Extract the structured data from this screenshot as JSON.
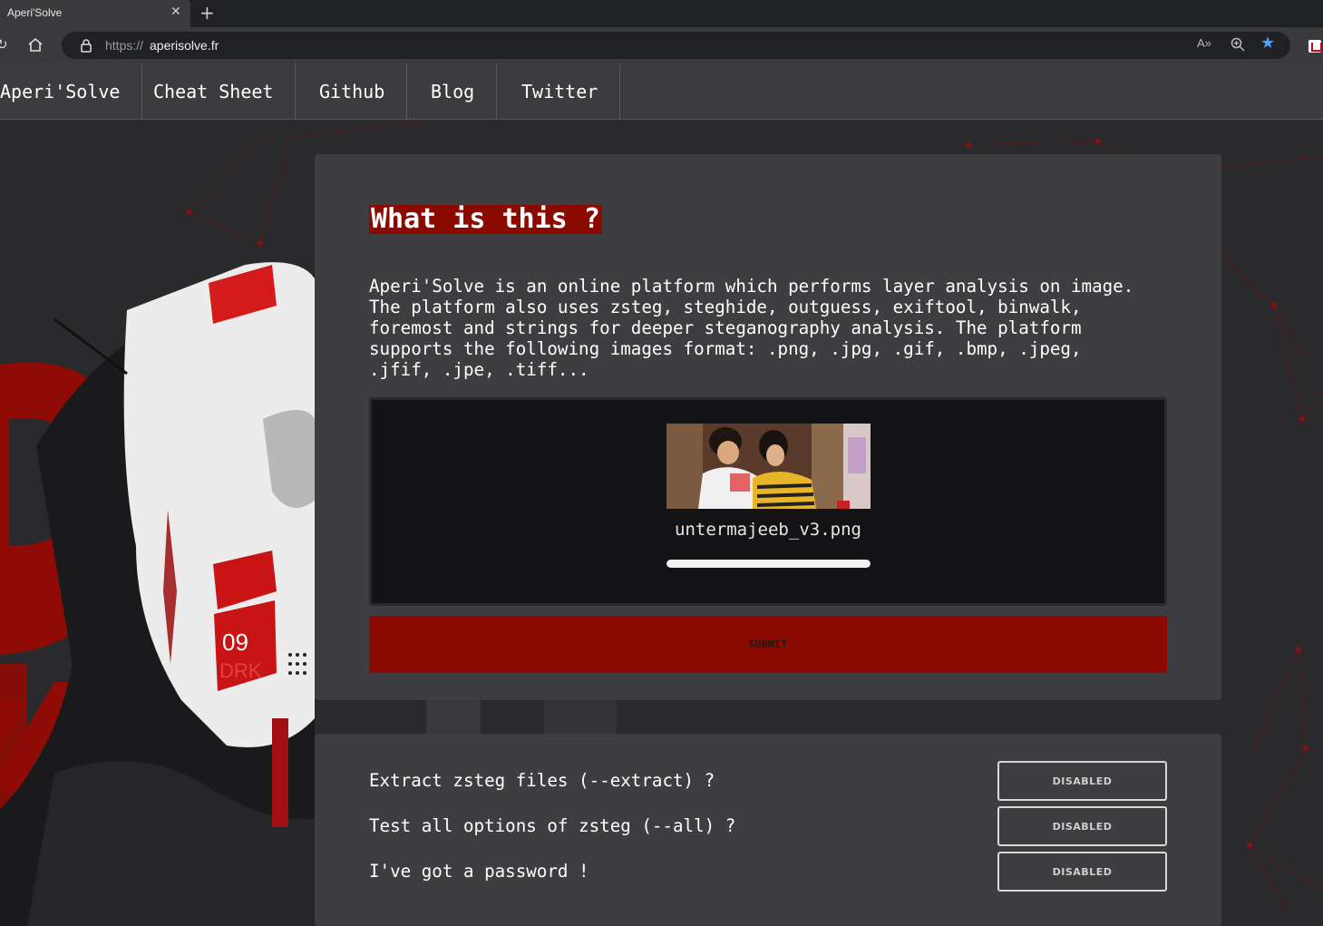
{
  "browser": {
    "tab_title": "Aperi'Solve",
    "url_scheme": "https://",
    "url_host": "aperisolve.fr",
    "read_aloud_label": "A»"
  },
  "nav": {
    "items": [
      {
        "label": "Aperi'Solve"
      },
      {
        "label": "Cheat Sheet"
      },
      {
        "label": "Github"
      },
      {
        "label": "Blog"
      },
      {
        "label": "Twitter"
      }
    ]
  },
  "intro": {
    "heading": "What is this ?",
    "description": "Aperi'Solve is an online platform which performs layer analysis on image.\nThe platform also uses zsteg, steghide, outguess, exiftool, binwalk,\nforemost and strings for deeper steganography analysis. The platform\nsupports the following images format: .png, .jpg, .gif, .bmp, .jpeg,\n.jfif, .jpe, .tiff..."
  },
  "upload": {
    "filename": "untermajeeb_v3.png",
    "progress": 1.0,
    "submit_label": "SUBMIT"
  },
  "options": [
    {
      "label": "Extract zsteg files (--extract) ?",
      "state": "DISABLED"
    },
    {
      "label": "Test all options of zsteg (--all) ?",
      "state": "DISABLED"
    },
    {
      "label": "I've got a password !",
      "state": "DISABLED"
    }
  ],
  "colors": {
    "accent": "#8b0a00",
    "card": "#3e3e41",
    "background": "#2a2a2d"
  }
}
